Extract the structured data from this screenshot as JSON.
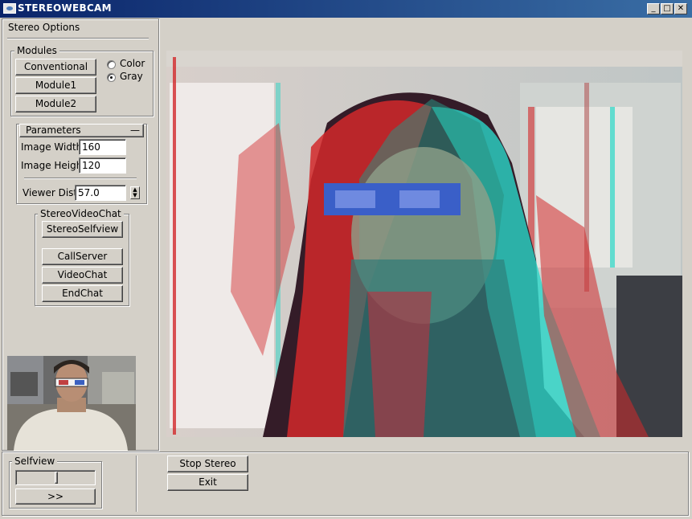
{
  "window": {
    "title": "STEREOWEBCAM",
    "controls": {
      "minimize": "_",
      "maximize": "□",
      "close": "✕"
    }
  },
  "stereo_options": {
    "title": "Stereo Options",
    "modules": {
      "legend": "Modules",
      "buttons": [
        "Conventional",
        "Module1",
        "Module2"
      ],
      "color_label": "Color",
      "gray_label": "Gray",
      "selected": "Gray"
    },
    "parameters": {
      "legend": "Parameters",
      "collapse_glyph": "—",
      "image_width_label": "Image Width",
      "image_width_value": "160",
      "image_height_label": "Image Height",
      "image_height_value": "120",
      "viewer_dist_label": "Viewer Dist",
      "viewer_dist_value": "57.0"
    },
    "videochat": {
      "legend": "StereoVideoChat",
      "selfview_button": "StereoSelfview",
      "callserver_button": "CallServer",
      "videochat_button": "VideoChat",
      "endchat_button": "EndChat"
    }
  },
  "selfview": {
    "legend": "Selfview",
    "slider_value": 0.5,
    "expand_button": ">>"
  },
  "actions": {
    "stop_stereo": "Stop Stereo",
    "exit": "Exit"
  },
  "colors": {
    "titlebar_start": "#0a246a",
    "titlebar_end": "#3a6ea5",
    "face": "#d4d0c8",
    "anaglyph_red": "#d2282a",
    "anaglyph_cyan": "#2ad7c8"
  }
}
